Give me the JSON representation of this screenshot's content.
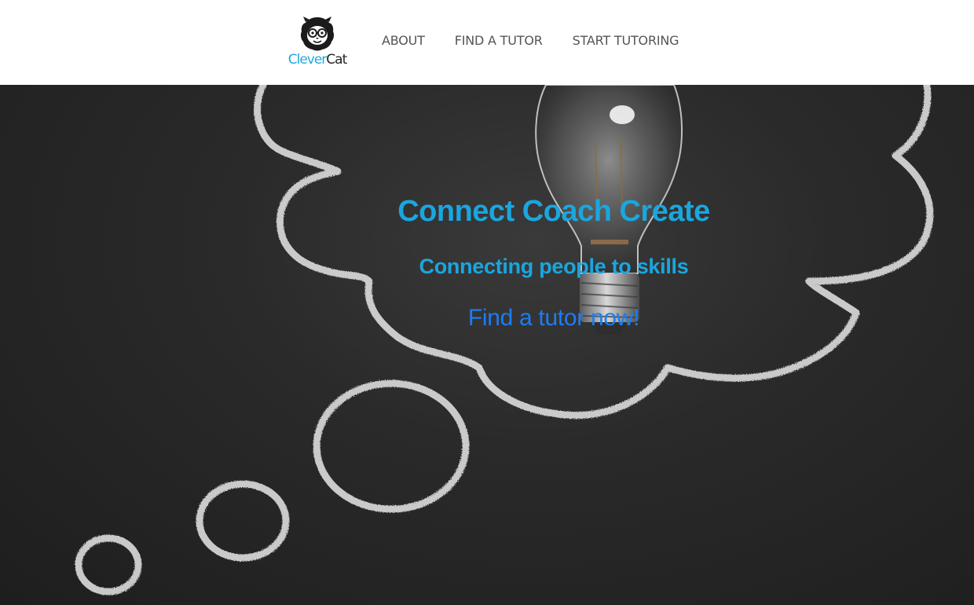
{
  "brand": {
    "name_part1": "Clever",
    "name_part2": "Cat",
    "logo_icon": "cat-with-glasses-icon",
    "color_light": "#22a9df",
    "color_dark": "#222222"
  },
  "nav": {
    "items": [
      {
        "label": "ABOUT"
      },
      {
        "label": "FIND A TUTOR"
      },
      {
        "label": "START TUTORING"
      }
    ]
  },
  "hero": {
    "title": "Connect Coach Create",
    "subtitle": "Connecting people to skills",
    "cta": "Find a tutor now!",
    "title_color": "#1aa6df",
    "cta_color": "#1d7cf2",
    "background": "chalkboard-thought-bubble-lightbulb"
  }
}
